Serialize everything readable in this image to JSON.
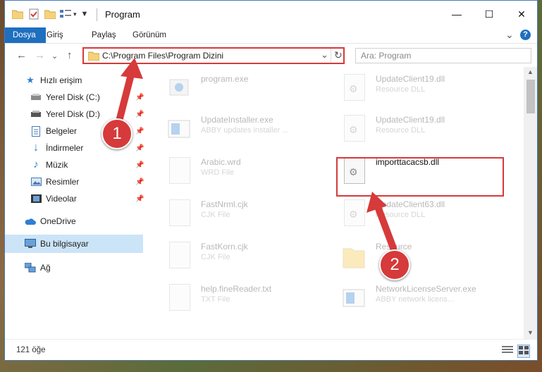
{
  "window": {
    "title": "Program",
    "controls": {
      "minimize": "—",
      "maximize": "☐",
      "close": "✕"
    }
  },
  "ribbon": {
    "tabs": [
      {
        "label": "Dosya",
        "active": true
      },
      {
        "label": "Giriş"
      },
      {
        "label": "Paylaş"
      },
      {
        "label": "Görünüm"
      }
    ],
    "expand": "⌄",
    "help": "?"
  },
  "address": {
    "path": "C:\\Program Files\\Program Dizini",
    "dropdown": "⌄",
    "refresh": "↻",
    "search_placeholder": "Ara: Program",
    "nav": {
      "back": "←",
      "forward": "→",
      "recent": "⌄",
      "up": "↑"
    }
  },
  "sidebar": {
    "quick_access": "Hızlı erişim",
    "items": [
      {
        "label": "Yerel Disk (C:)",
        "icon": "drive-icon"
      },
      {
        "label": "Yerel Disk (D:)",
        "icon": "drive-icon"
      },
      {
        "label": "Belgeler",
        "icon": "documents-icon"
      },
      {
        "label": "İndirmeler",
        "icon": "downloads-icon"
      },
      {
        "label": "Müzik",
        "icon": "music-icon"
      },
      {
        "label": "Resimler",
        "icon": "pictures-icon"
      },
      {
        "label": "Videolar",
        "icon": "videos-icon"
      }
    ],
    "onedrive": "OneDrive",
    "this_pc": "Bu bilgisayar",
    "network": "Ağ"
  },
  "files": {
    "left": [
      {
        "name": "program.exe",
        "desc": ""
      },
      {
        "name": "UpdateInstaller.exe",
        "desc": "ABBY updates installer ..."
      },
      {
        "name": "Arabic.wrd",
        "desc": "WRD File"
      },
      {
        "name": "FastNrml.cjk",
        "desc": "CJK File"
      },
      {
        "name": "FastKorn.cjk",
        "desc": "CJK File"
      },
      {
        "name": "help.fineReader.txt",
        "desc": "TXT File"
      }
    ],
    "right": [
      {
        "name": "UpdateClient19.dll",
        "desc": "Resource DLL"
      },
      {
        "name": "UpdateClient19.dll",
        "desc": "Resource DLL"
      },
      {
        "name": "importtacacsb.dll",
        "desc": ""
      },
      {
        "name": "UpdateClient63.dll",
        "desc": "Resource DLL"
      },
      {
        "name": "Resource",
        "desc": ""
      },
      {
        "name": "NetworkLicenseServer.exe",
        "desc": "ABBY network licens..."
      }
    ]
  },
  "status": {
    "count": "121 öğe"
  },
  "annotations": {
    "step1": "1",
    "step2": "2"
  },
  "colors": {
    "accent": "#1f6fbf",
    "highlight": "#d63a3a"
  }
}
